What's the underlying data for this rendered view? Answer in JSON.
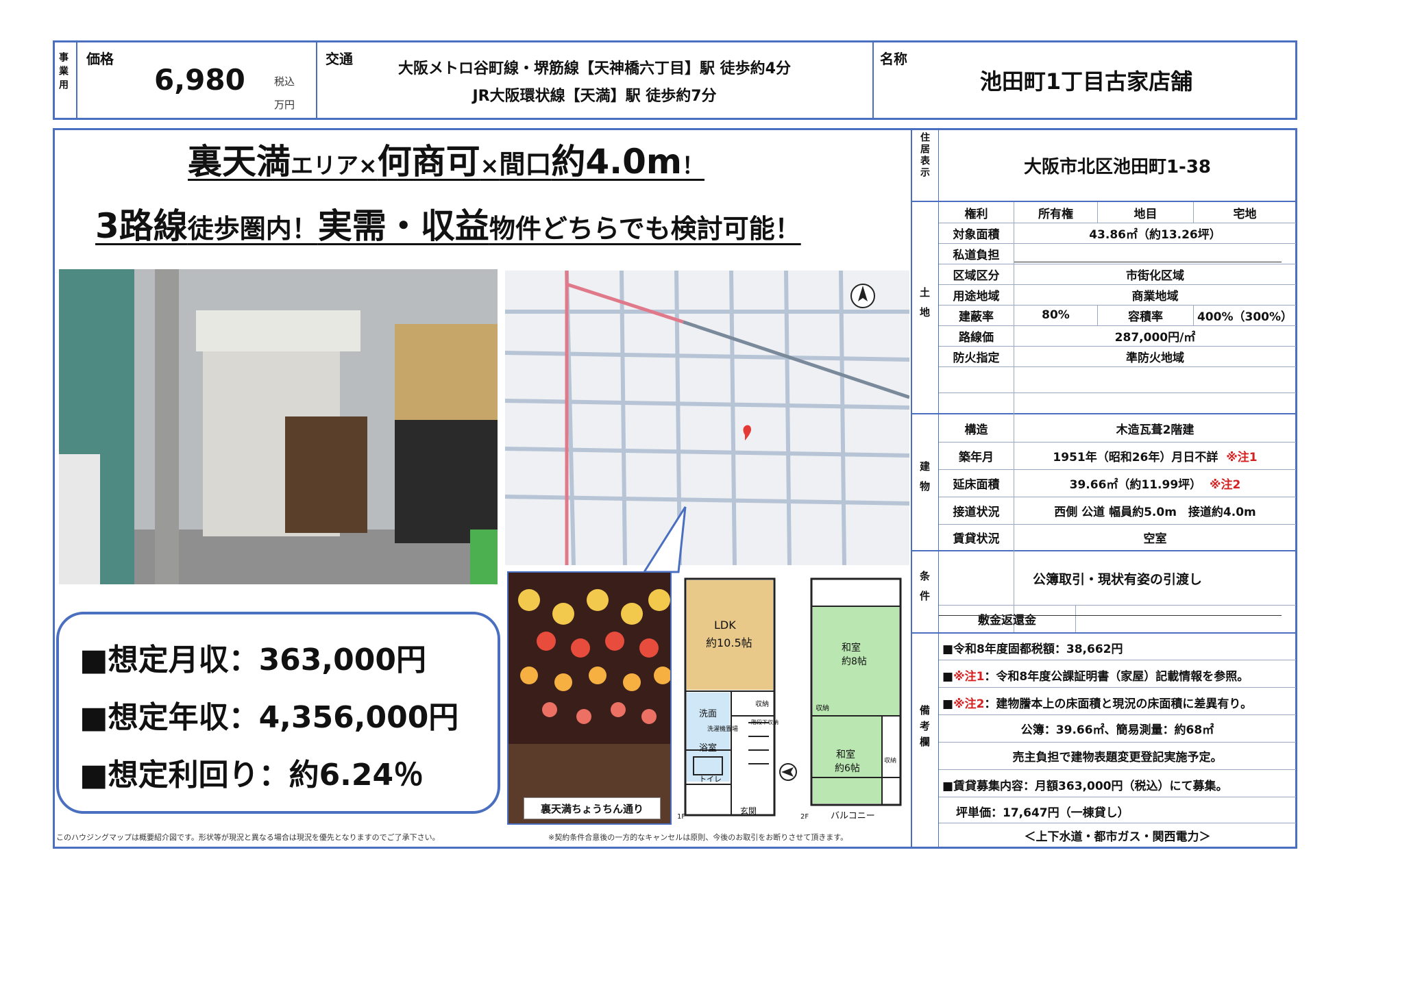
{
  "header": {
    "type_label": "事業用",
    "price_label": "価格",
    "price_value": "6,980",
    "tax_label": "税込",
    "unit_label": "万円",
    "access_label": "交通",
    "access_line1": "大阪メトロ谷町線・堺筋線【天神橋六丁目】駅 徒歩約4分",
    "access_line2": "JR大阪環状線【天満】駅 徒歩約7分",
    "name_label": "名称",
    "name_value": "池田町1丁目古家店舗"
  },
  "headline": {
    "l1a": "裏天満",
    "l1b": "エリア",
    "l1c": "×",
    "l1d": "何商可",
    "l1e": "×",
    "l1f": "間口",
    "l1g": "約4.0m",
    "l1h": "！",
    "l2a": "3路線",
    "l2b": "徒歩圏内！",
    "l2c": "実需・収益",
    "l2d": "物件どちらでも検討可能！"
  },
  "income": {
    "monthly": "■想定月収：363,000円",
    "annual": "■想定年収：4,356,000円",
    "yield": "■想定利回り：約6.24％"
  },
  "lantern_caption": "裏天満ちょうちん通り",
  "floorplan": {
    "ldk": "LDK",
    "ldk_size": "約10.5帖",
    "washroom": "洗面",
    "washer": "洗濯機置場",
    "bath": "浴室",
    "toilet": "トイレ",
    "entrance": "玄関",
    "storage": "収納",
    "stairs": "階段下収納",
    "washitsu": "和室",
    "size8": "約8帖",
    "size6": "約6帖",
    "balcony": "バルコニー",
    "f1": "1F",
    "f2": "2F"
  },
  "footnote_left": "このハウジングマップは概要紹介図です。形状等が現況と異なる場合は現況を優先となりますのでご了承下さい。",
  "footnote_right": "※契約条件合意後の一方的なキャンセルは原則、今後のお取引をお断りさせて頂きます。",
  "right_table": {
    "address_label": "住居表示",
    "address": "大阪市北区池田町1-38",
    "land_label": "土地",
    "rights_label": "権利",
    "rights": "所有権",
    "chimoku_label": "地目",
    "chimoku": "宅地",
    "area_label": "対象面積",
    "area": "43.86㎡（約13.26坪）",
    "private_road_label": "私道負担",
    "zone_label": "区域区分",
    "zone": "市街化区域",
    "use_label": "用途地域",
    "use": "商業地域",
    "bcr_label": "建蔽率",
    "bcr": "80%",
    "far_label": "容積率",
    "far": "400%（300%）",
    "road_price_label": "路線価",
    "road_price": "287,000円/㎡",
    "fire_label": "防火指定",
    "fire": "準防火地域",
    "bldg_label": "建物",
    "structure_label": "構造",
    "structure": "木造瓦葺2階建",
    "built_label": "築年月",
    "built": "1951年（昭和26年）月日不詳",
    "note1_mark": "※注1",
    "floor_label": "延床面積",
    "floor": "39.66㎡（約11.99坪）",
    "note2_mark": "※注2",
    "road_label": "接道状況",
    "road": "西側 公道 幅員約5.0m　接道約4.0m",
    "lease_label": "賃貸状況",
    "lease": "空室",
    "cond_label": "条件",
    "cond": "公簿取引・現状有姿の引渡し",
    "deposit_label": "敷金返還金",
    "remarks_label": "備考欄",
    "r1": "■令和8年度固都税額：38,662円",
    "r2_prefix": "■",
    "r2_mark": "※注1",
    "r2_text": "：令和8年度公課証明書（家屋）記載情報を参照。",
    "r3_prefix": "■",
    "r3_mark": "※注2",
    "r3_text": "：建物謄本上の床面積と現況の床面積に差異有り。",
    "r4": "公簿：39.66㎡、簡易測量：約68㎡",
    "r5": "売主負担で建物表題変更登記実施予定。",
    "r6": "■賃貸募集内容：月額363,000円（税込）にて募集。",
    "r7": "坪単価：17,647円（一棟貸し）",
    "r8": "＜上下水道・都市ガス・関西電力＞"
  }
}
